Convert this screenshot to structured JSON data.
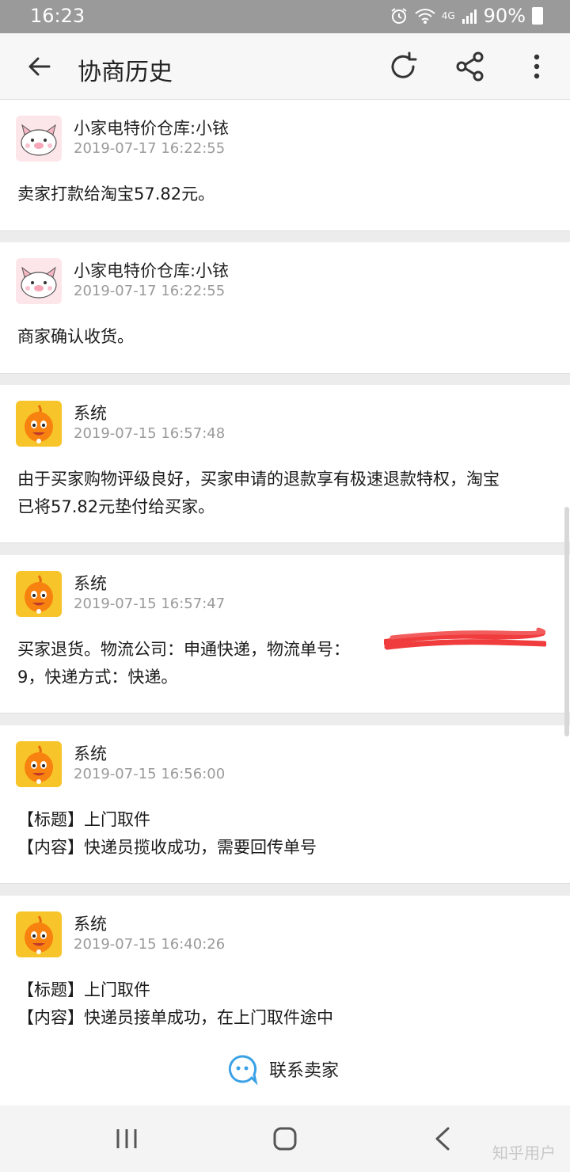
{
  "status_bar": {
    "time": "16:23",
    "battery": "90%",
    "network": "4G"
  },
  "app_bar": {
    "title": "协商历史"
  },
  "messages": [
    {
      "sender": "小家电特价仓库:小铱",
      "time": "2019-07-17 16:22:55",
      "lines": [
        "卖家打款给淘宝57.82元。"
      ],
      "avatar": "pig-avatar"
    },
    {
      "sender": "小家电特价仓库:小铱",
      "time": "2019-07-17 16:22:55",
      "lines": [
        "商家确认收货。"
      ],
      "avatar": "pig-avatar"
    },
    {
      "sender": "系统",
      "time": "2019-07-15 16:57:48",
      "lines": [
        "由于买家购物评级良好，买家申请的退款享有极速退款特权，淘宝",
        "已将57.82元垫付给买家。"
      ],
      "avatar": "taobao-mascot-avatar"
    },
    {
      "sender": "系统",
      "time": "2019-07-15 16:57:47",
      "lines": [
        "买家退货。物流公司：申通快递，物流单号：",
        "9，快递方式：快递。"
      ],
      "avatar": "taobao-mascot-avatar"
    },
    {
      "sender": "系统",
      "time": "2019-07-15 16:56:00",
      "lines": [
        "【标题】上门取件",
        "【内容】快递员揽收成功，需要回传单号"
      ],
      "avatar": "taobao-mascot-avatar"
    },
    {
      "sender": "系统",
      "time": "2019-07-15 16:40:26",
      "lines": [
        "【标题】上门取件",
        "【内容】快递员接单成功，在上门取件途中"
      ],
      "avatar": "taobao-mascot-avatar"
    }
  ],
  "contact_button": {
    "label": "联系卖家"
  },
  "watermark": "知乎用户",
  "colors": {
    "accent": "#3aa1e6",
    "redaction": "#f03c3c",
    "mascot": "#f7a21b"
  }
}
